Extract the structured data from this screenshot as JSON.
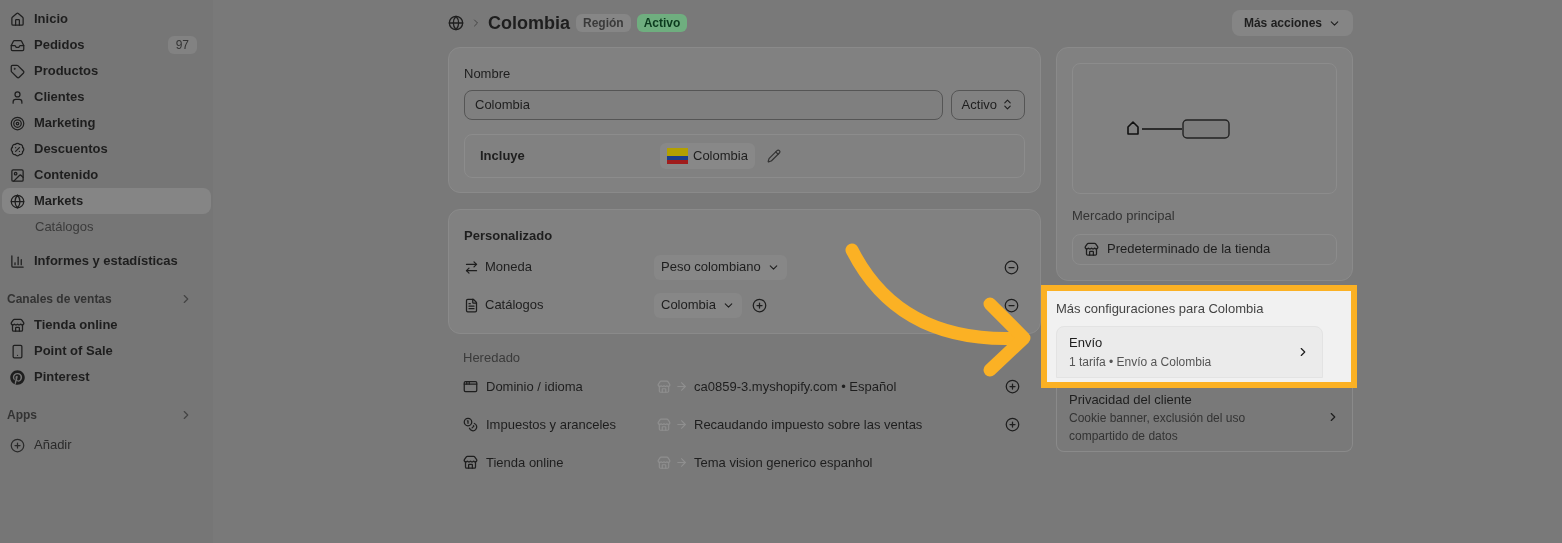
{
  "sidebar": {
    "items": [
      {
        "label": "Inicio",
        "selected": false,
        "kind": "main"
      },
      {
        "label": "Pedidos",
        "badge": "97",
        "selected": false,
        "kind": "main"
      },
      {
        "label": "Productos",
        "selected": false,
        "kind": "main"
      },
      {
        "label": "Clientes",
        "selected": false,
        "kind": "main"
      },
      {
        "label": "Marketing",
        "selected": false,
        "kind": "main"
      },
      {
        "label": "Descuentos",
        "selected": false,
        "kind": "main"
      },
      {
        "label": "Contenido",
        "selected": false,
        "kind": "main"
      },
      {
        "label": "Markets",
        "selected": true,
        "kind": "main"
      },
      {
        "label": "Catálogos",
        "selected": false,
        "kind": "sub"
      },
      {
        "label": "Informes y estadísticas",
        "selected": false,
        "kind": "main"
      }
    ],
    "sections": [
      {
        "title": "Canales de ventas",
        "items": [
          "Tienda online",
          "Point of Sale",
          "Pinterest"
        ]
      },
      {
        "title": "Apps"
      }
    ],
    "add": "Añadir"
  },
  "header": {
    "title": "Colombia",
    "badges": [
      {
        "label": "Región",
        "kind": "neutral"
      },
      {
        "label": "Activo",
        "kind": "success"
      }
    ],
    "actions": "Más acciones"
  },
  "name_card": {
    "label": "Nombre",
    "value": "Colombia",
    "status": "Activo",
    "includes_label": "Incluye",
    "includes_value": "Colombia"
  },
  "custom": {
    "title": "Personalizado",
    "rows": [
      {
        "label": "Moneda",
        "value": "Peso colombiano",
        "add": false
      },
      {
        "label": "Catálogos",
        "value": "Colombia",
        "add": true
      }
    ]
  },
  "inherited": {
    "title": "Heredado",
    "rows": [
      {
        "label": "Dominio / idioma",
        "value": "ca0859-3.myshopify.com • Español",
        "add": true
      },
      {
        "label": "Impuestos y aranceles",
        "value": "Recaudando impuesto sobre las ventas",
        "add": true
      },
      {
        "label": "Tienda online",
        "value": "Tema vision generico espanhol",
        "add": false
      }
    ]
  },
  "market": {
    "label": "Mercado principal",
    "value": "Predeterminado de la tienda"
  },
  "more": {
    "title": "Más configuraciones para Colombia",
    "items": [
      {
        "title": "Envío",
        "subtitle": "1 tarifa • Envío a Colombia",
        "highlighted": true
      },
      {
        "title": "Privacidad del cliente",
        "subtitle": "Cookie banner, exclusión del uso compartido de datos",
        "highlighted": false
      }
    ]
  }
}
